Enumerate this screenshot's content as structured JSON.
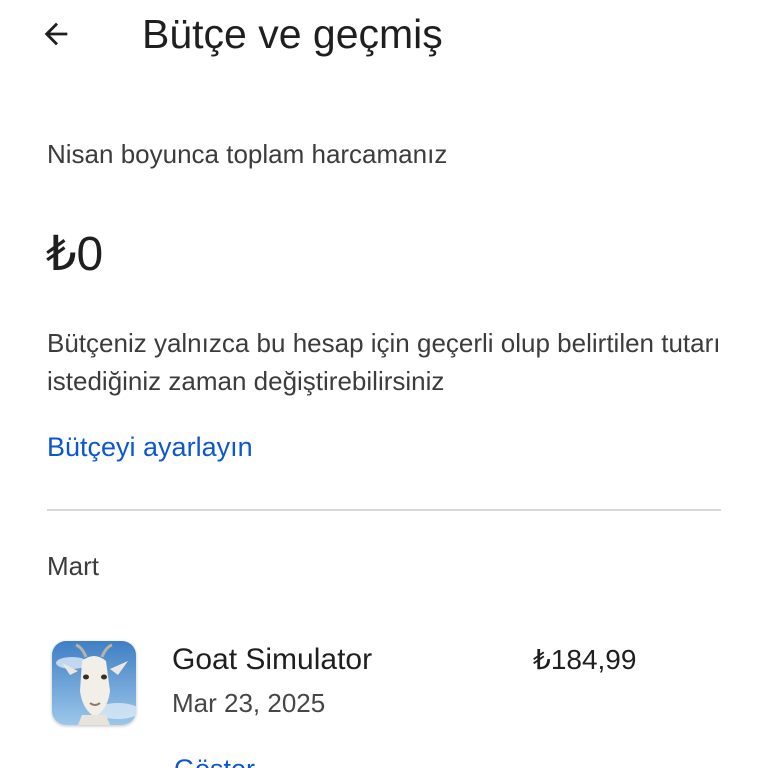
{
  "header": {
    "back_icon": "arrow-left-icon",
    "title": "Bütçe ve geçmiş"
  },
  "summary": {
    "label": "Nisan boyunca toplam harcamanız",
    "total": "₺0"
  },
  "budget": {
    "info": "Bütçeniz yalnızca bu hesap için geçerli olup belirtilen tutarı istediğiniz zaman değiştirebilirsiniz",
    "set_link": "Bütçeyi ayarlayın"
  },
  "history": {
    "month": "Mart",
    "items": [
      {
        "icon": "goat-simulator-app-icon",
        "name": "Goat Simulator",
        "date": "Mar 23, 2025",
        "price": "₺184,99",
        "show_label": "Göster"
      }
    ]
  },
  "colors": {
    "link": "#0b57d0",
    "text": "#1f1f1f",
    "secondary_text": "#3c3c3c",
    "divider": "#d9d9d9"
  }
}
